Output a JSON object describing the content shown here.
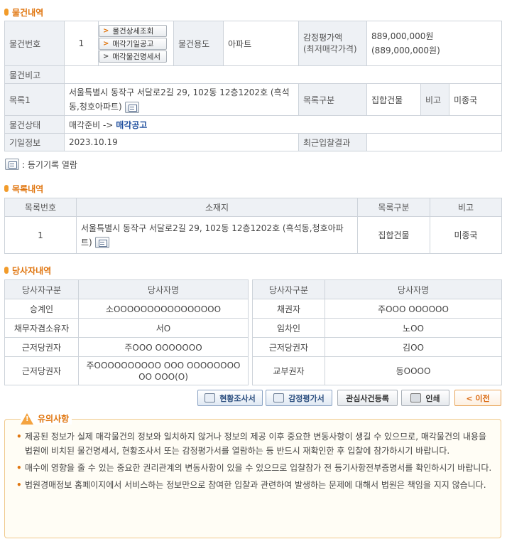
{
  "sections": {
    "property": "물건내역",
    "list": "목록내역",
    "parties": "당사자내역"
  },
  "property": {
    "labels": {
      "number": "물건번호",
      "usage": "물건용도",
      "appraisal": "감정평가액\n(최저매각가격)",
      "remark": "물건비고",
      "list1": "목록1",
      "list_type": "목록구분",
      "note": "비고",
      "status": "물건상태",
      "schedule": "기일정보",
      "recent_result": "최근입찰결과"
    },
    "values": {
      "number": "1",
      "usage": "아파트",
      "appraisal_1": "889,000,000원",
      "appraisal_2": "(889,000,000원)",
      "remark": "",
      "list1": "서울특별시 동작구 서달로2길 29, 102동 12층1202호 (흑석동,청호아파트)",
      "list_type": "집합건물",
      "note": "미종국",
      "status_prefix": "매각준비 -> ",
      "status_current": "매각공고",
      "schedule": "2023.10.19",
      "recent_result": ""
    },
    "buttons": {
      "detail": "물건상세조회",
      "notice": "매각기일공고",
      "statement": "매각물건명세서"
    }
  },
  "legend": ": 등기기록 열람",
  "list_table": {
    "headers": [
      "목록번호",
      "소재지",
      "목록구분",
      "비고"
    ],
    "row": {
      "no": "1",
      "address": "서울특별시 동작구 서달로2길 29, 102동 12층1202호 (흑석동,청호아파트)",
      "type": "집합건물",
      "note": "미종국"
    }
  },
  "party_table": {
    "headers": [
      "당사자구분",
      "당사자명",
      "당사자구분",
      "당사자명"
    ],
    "rows": [
      [
        "승계인",
        "소OOOOOOOOOOOOOOOO",
        "채권자",
        "주OOO OOOOOO"
      ],
      [
        "채무자겸소유자",
        "서O",
        "임차인",
        "노OO"
      ],
      [
        "근저당권자",
        "주OOO OOOOOOO",
        "근저당권자",
        "김OO"
      ],
      [
        "근저당권자",
        "주OOOOOOOOOO OOO OOOOOOOOOO OOO(O)",
        "교부권자",
        "동OOOO"
      ]
    ]
  },
  "actions": {
    "survey": "현황조사서",
    "appraisal": "감정평가서",
    "interest": "관심사건등록",
    "print": "인쇄",
    "prev": "< 이전"
  },
  "notice": {
    "title": "유의사항",
    "items": [
      "제공된 정보가 실제 매각물건의 정보와 일치하지 않거나 정보의 제공 이후 중요한 변동사항이 생길 수 있으므로, 매각물건의 내용을 법원에 비치된 물건명세서, 현황조사서 또는 감정평가서를 열람하는 등 반드시 재확인한 후 입찰에 참가하시기 바랍니다.",
      "매수에 영향을 줄 수 있는 중요한 권리관계의 변동사항이 있을 수 있으므로 입찰참가 전 등기사항전부증명서를 확인하시기 바랍니다.",
      "법원경매정보 홈페이지에서 서비스하는 정보만으로 참여한 입찰과 관련하여 발생하는 문제에 대해서 법원은 책임을 지지 않습니다."
    ]
  }
}
